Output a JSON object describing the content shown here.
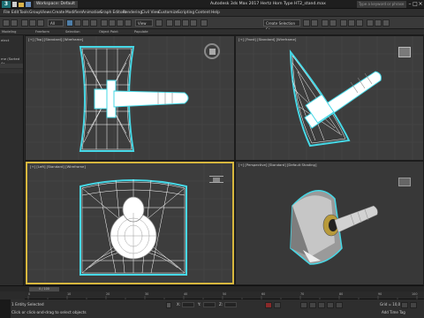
{
  "app": {
    "logo": "3",
    "workspace": "Workspace: Default",
    "title": "Autodesk 3ds Max 2017     Hertz Horn Type HT2_stand.max",
    "search_placeholder": "Type a keyword or phrase",
    "minimize": "–",
    "maximize": "□",
    "close": "×"
  },
  "menu": [
    "File",
    "Edit",
    "Tools",
    "Group",
    "Views",
    "Create",
    "Modifiers",
    "Animation",
    "Graph Editors",
    "Rendering",
    "Civil View",
    "Customize",
    "Scripting",
    "Content",
    "Help"
  ],
  "toolbar": {
    "filter_dropdown": "All",
    "view_dropdown": "View",
    "selection_set": "Create Selection Se"
  },
  "ribbon": [
    "Modeling",
    "Freeform",
    "Selection",
    "Object Paint",
    "Populate"
  ],
  "sidepanel": {
    "label1": "elect",
    "label2": "me (Sorted As"
  },
  "viewports": {
    "top": "[+] [Top] [Standard] [Wireframe]",
    "front": "[+] [Front] [Standard] [Wireframe]",
    "left": "[+] [Left] [Standard] [Wireframe]",
    "perspective": "[+] [Perspective] [Standard] [Default Shading]"
  },
  "timeline": {
    "slider": "0 / 100",
    "ticks": [
      "0",
      "10",
      "20",
      "30",
      "40",
      "50",
      "60",
      "70",
      "80",
      "90",
      "100"
    ]
  },
  "status": {
    "selection": "1 Entity Selected",
    "prompt": "Click or click-and-drag to select objects",
    "grid": "Grid = 10,0",
    "add_time_tag": "Add Time Tag",
    "x_label": "X:",
    "y_label": "Y:",
    "z_label": "Z:"
  },
  "colors": {
    "accent": "#d7b73e",
    "wire": "#ffffff",
    "selection_outline": "#46d8e6",
    "viewport_bg": "#3d3d3d",
    "perspective_bg": "#383838"
  }
}
